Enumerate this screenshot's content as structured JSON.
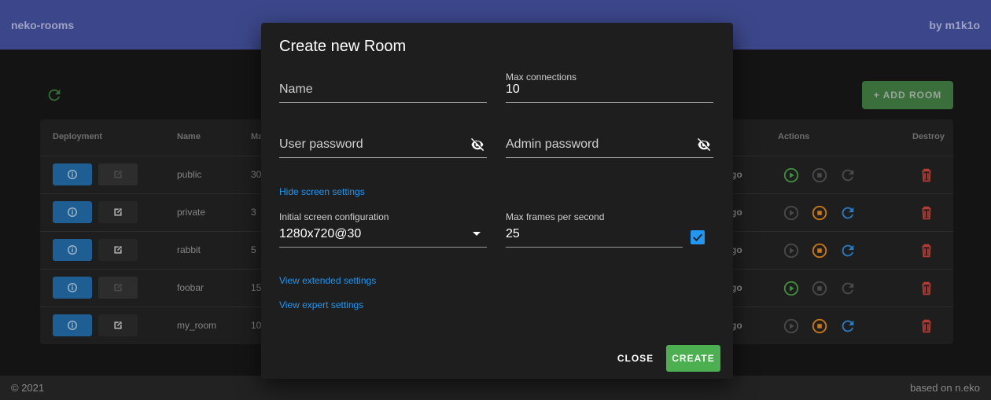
{
  "app": {
    "title": "neko-rooms",
    "author": "by m1k1o"
  },
  "footer": {
    "copyright": "© 2021",
    "based_on": "based on n.eko"
  },
  "toolbar": {
    "refresh_icon": "refresh-icon",
    "add_room_label": "+ ADD ROOM"
  },
  "table": {
    "headers": {
      "deployment": "Deployment",
      "name": "Name",
      "max": "Ma",
      "actions": "Actions",
      "destroy": "Destroy"
    },
    "rows": [
      {
        "name": "public",
        "max": "30",
        "status": "go",
        "running": false,
        "external_enabled": false
      },
      {
        "name": "private",
        "max": "3",
        "status": "go",
        "running": true,
        "external_enabled": true
      },
      {
        "name": "rabbit",
        "max": "5",
        "status": "go",
        "running": true,
        "external_enabled": true
      },
      {
        "name": "foobar",
        "max": "15",
        "status": "go",
        "running": false,
        "external_enabled": false
      },
      {
        "name": "my_room",
        "max": "10",
        "status": "go",
        "running": true,
        "external_enabled": true
      }
    ]
  },
  "colors": {
    "start": "#3f8f3f",
    "stop": "#c97a12",
    "restart": "#2a7ac0",
    "destroy": "#b53a35",
    "disabled": "#4a4a4a"
  },
  "modal": {
    "title": "Create new Room",
    "name_placeholder": "Name",
    "max_connections_label": "Max connections",
    "max_connections_value": "10",
    "user_password_placeholder": "User password",
    "admin_password_placeholder": "Admin password",
    "hide_screen_settings": "Hide screen settings",
    "screen_config_label": "Initial screen configuration",
    "screen_config_value": "1280x720@30",
    "max_fps_label": "Max frames per second",
    "max_fps_value": "25",
    "max_fps_checked": true,
    "view_extended": "View extended settings",
    "view_expert": "View expert settings",
    "close_label": "CLOSE",
    "create_label": "CREATE"
  }
}
